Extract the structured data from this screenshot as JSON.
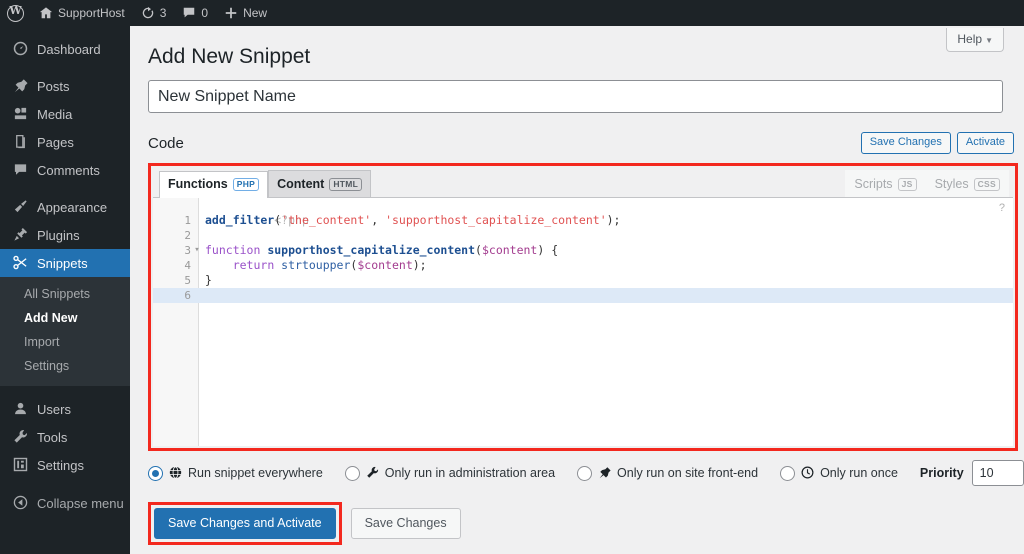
{
  "adminbar": {
    "items": [
      {
        "icon": "wordpress-logo-icon",
        "label": ""
      },
      {
        "icon": "home-icon",
        "label": "SupportHost"
      },
      {
        "icon": "updates-icon",
        "label": "3"
      },
      {
        "icon": "comments-icon",
        "label": "0"
      },
      {
        "icon": "plus-icon",
        "label": "New"
      }
    ]
  },
  "sidebar": {
    "items": [
      {
        "icon": "dashboard-icon",
        "label": "Dashboard"
      },
      {
        "icon": "pin-icon",
        "label": "Posts"
      },
      {
        "icon": "media-icon",
        "label": "Media"
      },
      {
        "icon": "pages-icon",
        "label": "Pages"
      },
      {
        "icon": "comments-icon",
        "label": "Comments"
      },
      {
        "icon": "appearance-icon",
        "label": "Appearance"
      },
      {
        "icon": "plugins-icon",
        "label": "Plugins"
      },
      {
        "icon": "scissors-icon",
        "label": "Snippets"
      },
      {
        "icon": "users-icon",
        "label": "Users"
      },
      {
        "icon": "tools-icon",
        "label": "Tools"
      },
      {
        "icon": "settings-icon",
        "label": "Settings"
      }
    ],
    "submenu": [
      {
        "label": "All Snippets"
      },
      {
        "label": "Add New"
      },
      {
        "label": "Import"
      },
      {
        "label": "Settings"
      }
    ],
    "collapse": {
      "icon": "collapse-icon",
      "label": "Collapse menu"
    },
    "active_item": "Snippets",
    "active_submenu": "Add New",
    "accent_color": "#2271b1"
  },
  "header": {
    "help_label": "Help",
    "help_caret": "▼",
    "page_title": "Add New Snippet"
  },
  "snippet_name": {
    "value": "",
    "placeholder": "New Snippet Name"
  },
  "code_section": {
    "heading": "Code",
    "save_changes_label": "Save Changes",
    "activate_label": "Activate",
    "tabs": [
      {
        "label": "Functions",
        "badge": "PHP",
        "state": "active"
      },
      {
        "label": "Content",
        "badge": "HTML",
        "state": "inactive"
      },
      {
        "label": "Scripts",
        "badge": "JS",
        "state": "disabled"
      },
      {
        "label": "Styles",
        "badge": "CSS",
        "state": "disabled"
      }
    ],
    "hint_glyph": "?",
    "opener": "<?php",
    "lines": [
      {
        "number": "1",
        "fold": "",
        "active": false,
        "tokens": [
          {
            "t": "add_filter",
            "c": "fn"
          },
          {
            "t": "(",
            "c": "pun"
          },
          {
            "t": "'the_content'",
            "c": "str"
          },
          {
            "t": ", ",
            "c": "pun"
          },
          {
            "t": "'supporthost_capitalize_content'",
            "c": "str"
          },
          {
            "t": ");",
            "c": "pun"
          }
        ]
      },
      {
        "number": "2",
        "fold": "",
        "active": false,
        "tokens": []
      },
      {
        "number": "3",
        "fold": "▾",
        "active": false,
        "tokens": [
          {
            "t": "function ",
            "c": "kw"
          },
          {
            "t": "supporthost_capitalize_content",
            "c": "fn"
          },
          {
            "t": "(",
            "c": "pun"
          },
          {
            "t": "$content",
            "c": "var"
          },
          {
            "t": ") {",
            "c": "pun"
          }
        ]
      },
      {
        "number": "4",
        "fold": "",
        "active": false,
        "tokens": [
          {
            "t": "    ",
            "c": "pun"
          },
          {
            "t": "return ",
            "c": "kw"
          },
          {
            "t": "strtoupper",
            "c": "fn2"
          },
          {
            "t": "(",
            "c": "pun"
          },
          {
            "t": "$content",
            "c": "var"
          },
          {
            "t": ");",
            "c": "pun"
          }
        ]
      },
      {
        "number": "5",
        "fold": "",
        "active": false,
        "tokens": [
          {
            "t": "}",
            "c": "pun"
          }
        ]
      },
      {
        "number": "6",
        "fold": "",
        "active": true,
        "tokens": []
      }
    ],
    "highlight_color": "#f3281e"
  },
  "scope": {
    "options": [
      {
        "icon": "globe-icon",
        "glyph": "🌐",
        "label": "Run snippet everywhere",
        "checked": true
      },
      {
        "icon": "wrench-icon",
        "glyph": "🔧",
        "label": "Only run in administration area",
        "checked": false
      },
      {
        "icon": "pin-icon",
        "glyph": "📌",
        "label": "Only run on site front-end",
        "checked": false
      },
      {
        "icon": "clock-icon",
        "glyph": "🕓",
        "label": "Only run once",
        "checked": false
      }
    ],
    "priority_label": "Priority",
    "priority_value": "10"
  },
  "footer": {
    "save_activate_label": "Save Changes and Activate",
    "save_label": "Save Changes"
  }
}
